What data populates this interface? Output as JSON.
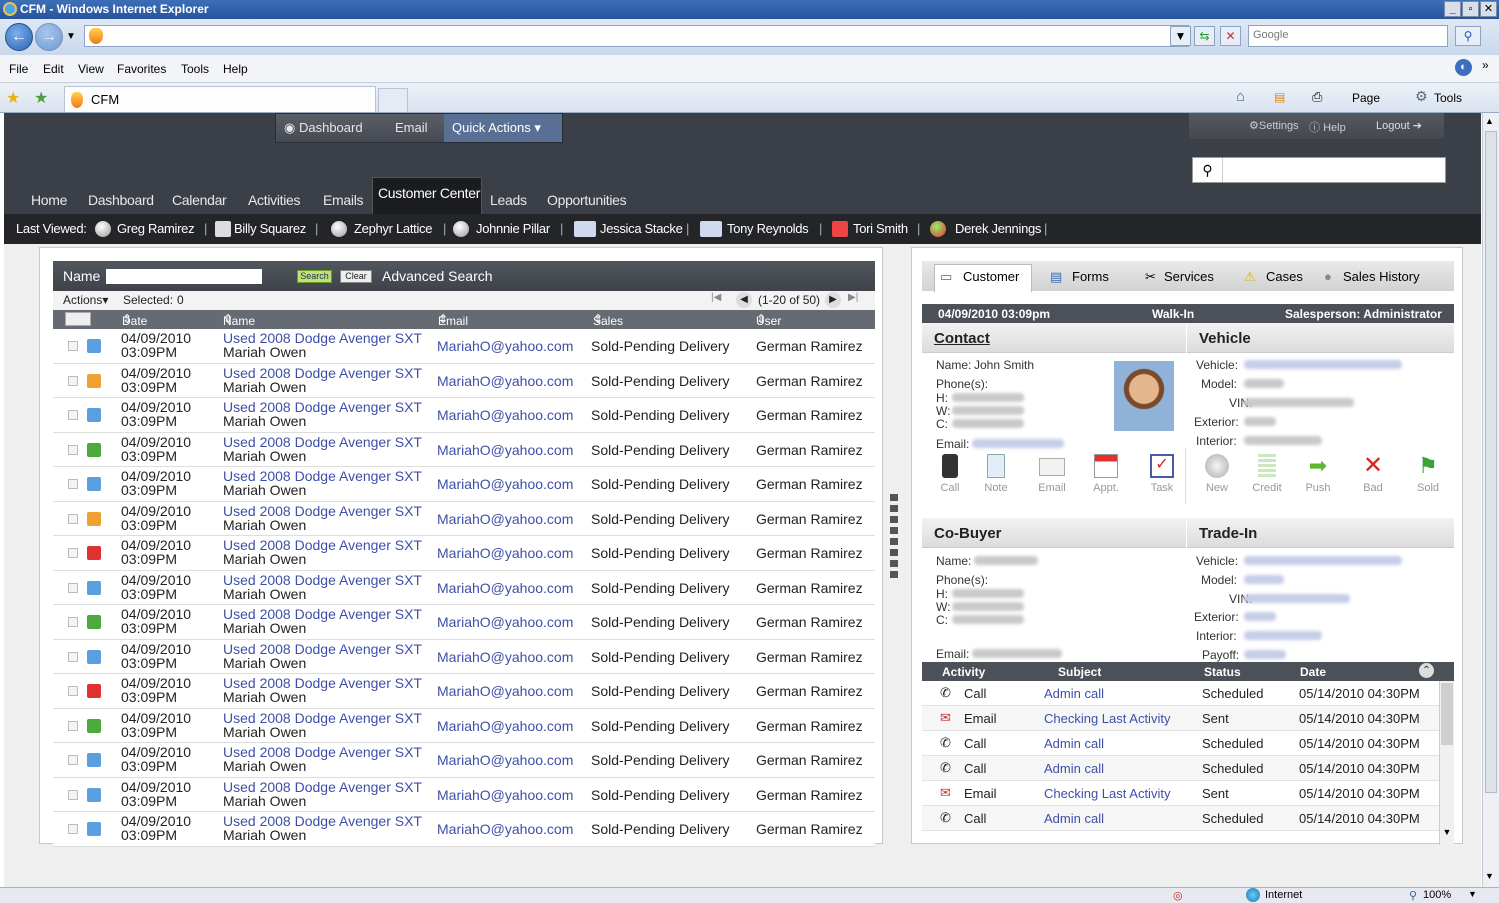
{
  "window": {
    "title": "CFM - Windows Internet Explorer"
  },
  "browser": {
    "search_placeholder": "Google",
    "menu": [
      "File",
      "Edit",
      "View",
      "Favorites",
      "Tools",
      "Help"
    ],
    "tab_title": "CFM",
    "page_label": "Page",
    "tools_label": "Tools",
    "status_zone": "Internet",
    "zoom": "100%"
  },
  "header": {
    "top_buttons": [
      "Dashboard",
      "Email",
      "Quick Actions"
    ],
    "settings": "Settings",
    "help": "Help",
    "logout": "Logout",
    "nav_tabs": [
      "Home",
      "Dashboard",
      "Calendar",
      "Activities",
      "Emails",
      "Customer Center",
      "Leads",
      "Opportunities"
    ],
    "active_tab": "Customer Center"
  },
  "last_viewed": {
    "label": "Last Viewed:",
    "items": [
      "Greg Ramirez",
      "Billy Squarez",
      "Zephyr Lattice",
      "Johnnie Pillar",
      "Jessica Stacke",
      "Tony Reynolds",
      "Tori Smith",
      "Derek Jennings"
    ]
  },
  "left_panel": {
    "search_label": "Name",
    "search_button": "Search",
    "clear_button": "Clear",
    "advanced_search": "Advanced Search",
    "actions_label": "Actions",
    "selected_label": "Selected:",
    "selected_count": "0",
    "pagination": "(1-20 of 50)",
    "columns": [
      "Date Entered",
      "Name",
      "Email",
      "Sales Stage",
      "User"
    ],
    "rows": [
      {
        "date": "04/09/2010",
        "time": "03:09PM",
        "vehicle": "Used 2008 Dodge Avenger SXT",
        "name": "Mariah Owen",
        "email": "MariahO@yahoo.com",
        "stage": "Sold-Pending Delivery",
        "user": "German Ramirez",
        "icon": "#5aa0e0"
      },
      {
        "date": "04/09/2010",
        "time": "03:09PM",
        "vehicle": "Used 2008 Dodge Avenger SXT",
        "name": "Mariah Owen",
        "email": "MariahO@yahoo.com",
        "stage": "Sold-Pending Delivery",
        "user": "German Ramirez",
        "icon": "#f0a030"
      },
      {
        "date": "04/09/2010",
        "time": "03:09PM",
        "vehicle": "Used 2008 Dodge Avenger SXT",
        "name": "Mariah Owen",
        "email": "MariahO@yahoo.com",
        "stage": "Sold-Pending Delivery",
        "user": "German Ramirez",
        "icon": "#5aa0e0"
      },
      {
        "date": "04/09/2010",
        "time": "03:09PM",
        "vehicle": "Used 2008 Dodge Avenger SXT",
        "name": "Mariah Owen",
        "email": "MariahO@yahoo.com",
        "stage": "Sold-Pending Delivery",
        "user": "German Ramirez",
        "icon": "#4caa3c"
      },
      {
        "date": "04/09/2010",
        "time": "03:09PM",
        "vehicle": "Used 2008 Dodge Avenger SXT",
        "name": "Mariah Owen",
        "email": "MariahO@yahoo.com",
        "stage": "Sold-Pending Delivery",
        "user": "German Ramirez",
        "icon": "#5aa0e0"
      },
      {
        "date": "04/09/2010",
        "time": "03:09PM",
        "vehicle": "Used 2008 Dodge Avenger SXT",
        "name": "Mariah Owen",
        "email": "MariahO@yahoo.com",
        "stage": "Sold-Pending Delivery",
        "user": "German Ramirez",
        "icon": "#f0a030"
      },
      {
        "date": "04/09/2010",
        "time": "03:09PM",
        "vehicle": "Used 2008 Dodge Avenger SXT",
        "name": "Mariah Owen",
        "email": "MariahO@yahoo.com",
        "stage": "Sold-Pending Delivery",
        "user": "German Ramirez",
        "icon": "#e03030"
      },
      {
        "date": "04/09/2010",
        "time": "03:09PM",
        "vehicle": "Used 2008 Dodge Avenger SXT",
        "name": "Mariah Owen",
        "email": "MariahO@yahoo.com",
        "stage": "Sold-Pending Delivery",
        "user": "German Ramirez",
        "icon": "#5aa0e0"
      },
      {
        "date": "04/09/2010",
        "time": "03:09PM",
        "vehicle": "Used 2008 Dodge Avenger SXT",
        "name": "Mariah Owen",
        "email": "MariahO@yahoo.com",
        "stage": "Sold-Pending Delivery",
        "user": "German Ramirez",
        "icon": "#4caa3c"
      },
      {
        "date": "04/09/2010",
        "time": "03:09PM",
        "vehicle": "Used 2008 Dodge Avenger SXT",
        "name": "Mariah Owen",
        "email": "MariahO@yahoo.com",
        "stage": "Sold-Pending Delivery",
        "user": "German Ramirez",
        "icon": "#5aa0e0"
      },
      {
        "date": "04/09/2010",
        "time": "03:09PM",
        "vehicle": "Used 2008 Dodge Avenger SXT",
        "name": "Mariah Owen",
        "email": "MariahO@yahoo.com",
        "stage": "Sold-Pending Delivery",
        "user": "German Ramirez",
        "icon": "#e03030"
      },
      {
        "date": "04/09/2010",
        "time": "03:09PM",
        "vehicle": "Used 2008 Dodge Avenger SXT",
        "name": "Mariah Owen",
        "email": "MariahO@yahoo.com",
        "stage": "Sold-Pending Delivery",
        "user": "German Ramirez",
        "icon": "#4caa3c"
      },
      {
        "date": "04/09/2010",
        "time": "03:09PM",
        "vehicle": "Used 2008 Dodge Avenger SXT",
        "name": "Mariah Owen",
        "email": "MariahO@yahoo.com",
        "stage": "Sold-Pending Delivery",
        "user": "German Ramirez",
        "icon": "#5aa0e0"
      },
      {
        "date": "04/09/2010",
        "time": "03:09PM",
        "vehicle": "Used 2008 Dodge Avenger SXT",
        "name": "Mariah Owen",
        "email": "MariahO@yahoo.com",
        "stage": "Sold-Pending Delivery",
        "user": "German Ramirez",
        "icon": "#5aa0e0"
      },
      {
        "date": "04/09/2010",
        "time": "03:09PM",
        "vehicle": "Used 2008 Dodge Avenger SXT",
        "name": "Mariah Owen",
        "email": "MariahO@yahoo.com",
        "stage": "Sold-Pending Delivery",
        "user": "German Ramirez",
        "icon": "#5aa0e0"
      }
    ]
  },
  "right_panel": {
    "tabs": [
      "Customer",
      "Forms",
      "Services",
      "Cases",
      "Sales History"
    ],
    "info_bar": {
      "datetime": "04/09/2010 03:09pm",
      "source": "Walk-In",
      "salesperson": "Salesperson: Administrator"
    },
    "contact": {
      "title": "Contact",
      "name_label": "Name:",
      "name": "John Smith",
      "phones_label": "Phone(s):",
      "h": "H:",
      "w": "W:",
      "c": "C:",
      "email_label": "Email:"
    },
    "vehicle": {
      "title": "Vehicle",
      "labels": [
        "Vehicle:",
        "Model:",
        "VIN:",
        "Exterior:",
        "Interior:"
      ]
    },
    "contact_actions": [
      "Call",
      "Note",
      "Email",
      "Appt.",
      "Task"
    ],
    "vehicle_actions": [
      "New",
      "Credit",
      "Push",
      "Bad",
      "Sold"
    ],
    "cobuyer": {
      "title": "Co-Buyer",
      "name_label": "Name:",
      "phones_label": "Phone(s):",
      "h": "H:",
      "w": "W:",
      "c": "C:",
      "email_label": "Email:"
    },
    "tradein": {
      "title": "Trade-In",
      "labels": [
        "Vehicle:",
        "Model:",
        "VIN:",
        "Exterior:",
        "Interior:",
        "Payoff:"
      ]
    },
    "activity_columns": [
      "Activity",
      "Subject",
      "Status",
      "Date"
    ],
    "activities": [
      {
        "type": "Call",
        "subject": "Admin call",
        "status": "Scheduled",
        "date": "05/14/2010 04:30PM"
      },
      {
        "type": "Email",
        "subject": "Checking Last Activity",
        "status": "Sent",
        "date": "05/14/2010 04:30PM"
      },
      {
        "type": "Call",
        "subject": "Admin call",
        "status": "Scheduled",
        "date": "05/14/2010 04:30PM"
      },
      {
        "type": "Call",
        "subject": "Admin call",
        "status": "Scheduled",
        "date": "05/14/2010 04:30PM"
      },
      {
        "type": "Email",
        "subject": "Checking Last Activity",
        "status": "Sent",
        "date": "05/14/2010 04:30PM"
      },
      {
        "type": "Call",
        "subject": "Admin call",
        "status": "Scheduled",
        "date": "05/14/2010 04:30PM"
      }
    ]
  }
}
